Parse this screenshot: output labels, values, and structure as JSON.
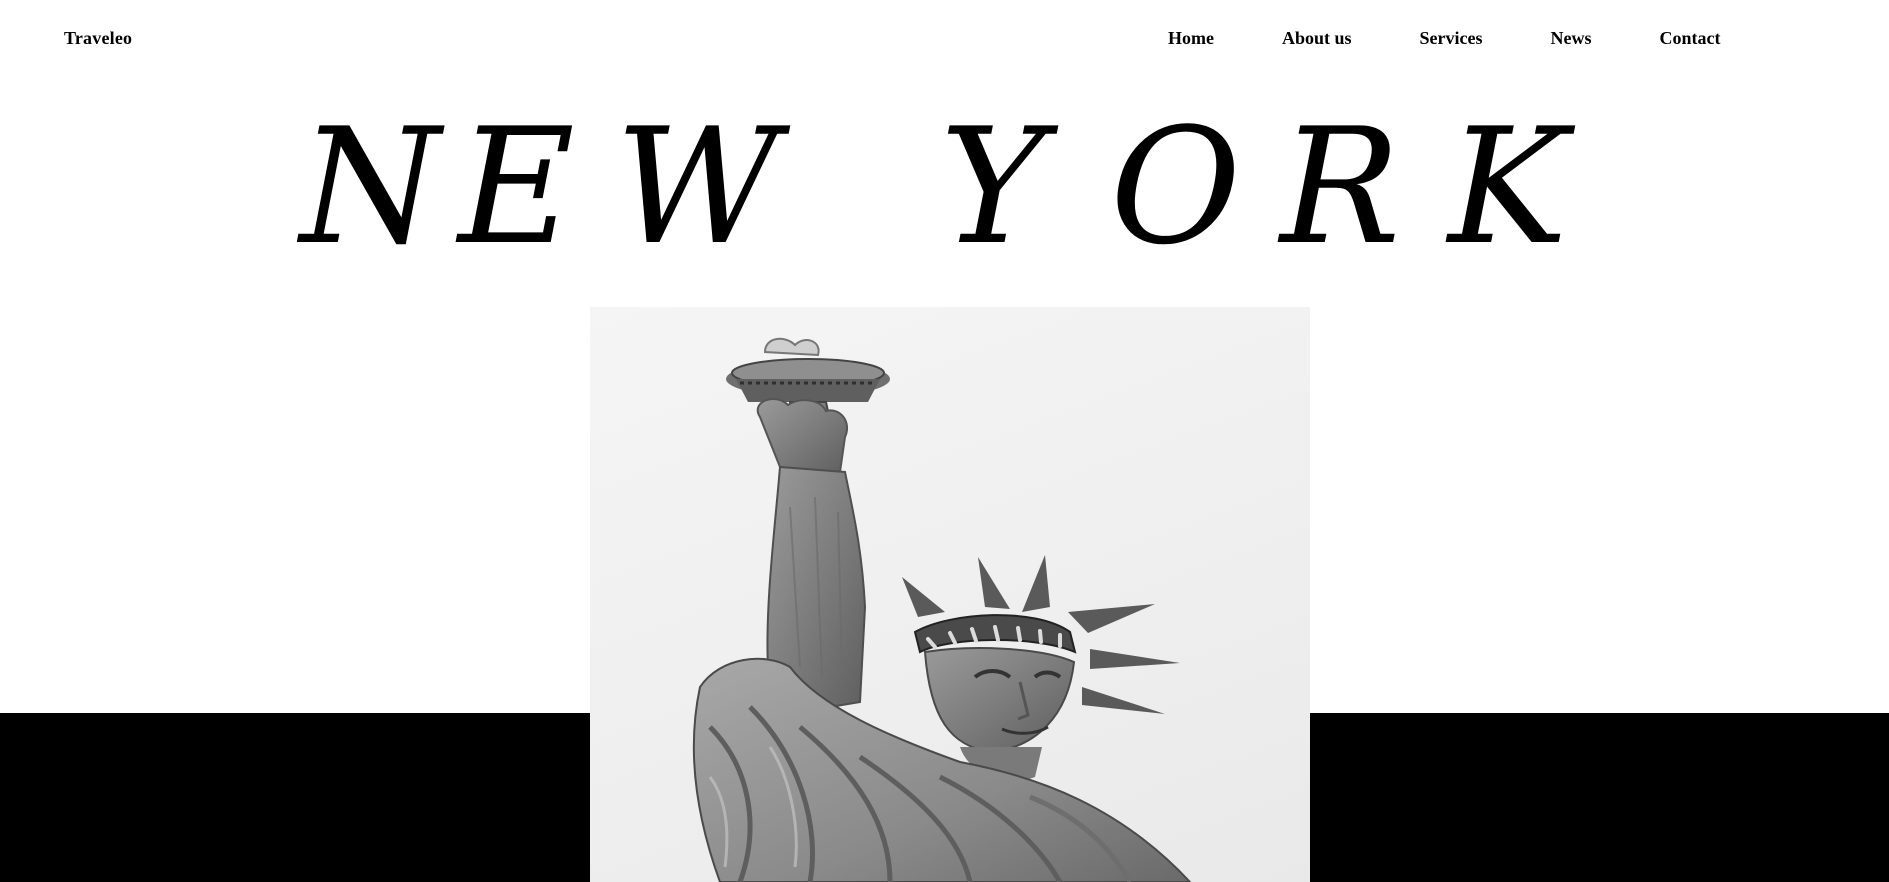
{
  "brand": {
    "name": "Traveleo"
  },
  "nav": {
    "items": [
      {
        "label": "Home"
      },
      {
        "label": "About us"
      },
      {
        "label": "Services"
      },
      {
        "label": "News"
      },
      {
        "label": "Contact"
      }
    ]
  },
  "hero": {
    "title": "NEW YORK",
    "letters": [
      "N",
      "E",
      "W",
      "Y",
      "O",
      "R",
      "K"
    ],
    "image_subject": "statue-of-liberty"
  },
  "colors": {
    "background": "#ffffff",
    "text": "#000000",
    "band": "#000000"
  }
}
